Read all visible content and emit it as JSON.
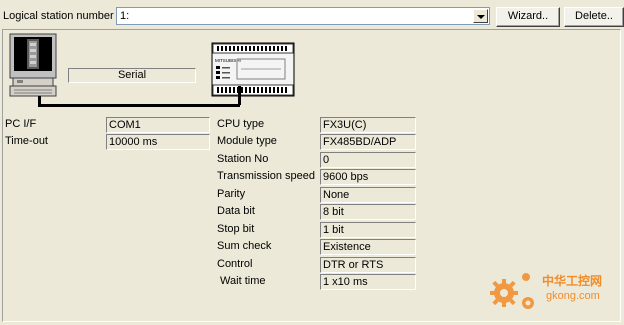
{
  "top_bar": {
    "label": "Logical station number",
    "station_value": "1:",
    "wizard_label": "Wizard..",
    "delete_label": "Delete.."
  },
  "diagram": {
    "serial_label": "Serial",
    "plc_brand": "MITSUBISHI"
  },
  "pc_settings": [
    {
      "label": "PC I/F",
      "value": "COM1"
    },
    {
      "label": "Time-out",
      "value": "10000 ms"
    }
  ],
  "plc_settings": [
    {
      "label": "CPU type",
      "value": "FX3U(C)"
    },
    {
      "label": "Module type",
      "value": "FX485BD/ADP"
    },
    {
      "label": "Station No",
      "value": "0"
    },
    {
      "label": "Transmission speed",
      "value": "9600 bps"
    },
    {
      "label": "Parity",
      "value": "None"
    },
    {
      "label": "Data bit",
      "value": "8 bit"
    },
    {
      "label": "Stop bit",
      "value": "1 bit"
    },
    {
      "label": "Sum check",
      "value": "Existence"
    },
    {
      "label": "Control",
      "value": "DTR or RTS"
    },
    {
      "label": " Wait time",
      "value": "1 x10 ms"
    }
  ],
  "watermark": {
    "cn_text": "中华工控网",
    "url_text": "gkong.com"
  },
  "colors": {
    "window_bg": "#ece9d8",
    "field_border_dark": "#808080",
    "watermark_orange": "#f28c28"
  }
}
